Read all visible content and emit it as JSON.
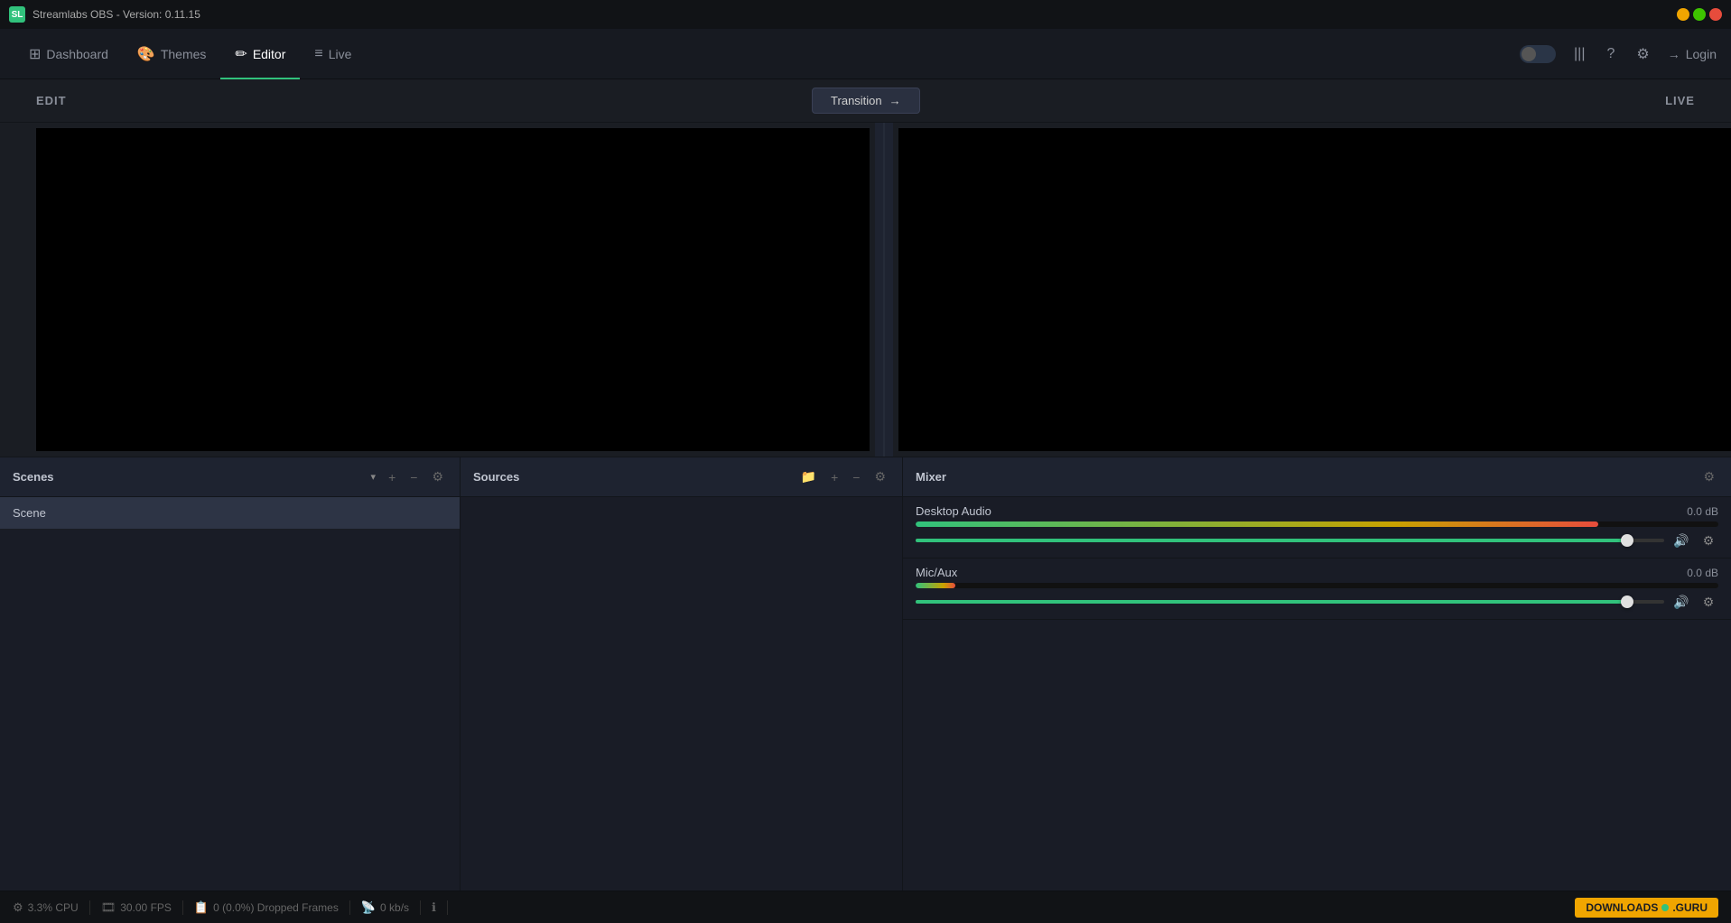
{
  "app": {
    "title": "Streamlabs OBS - Version: 0.11.15",
    "icon_label": "SL"
  },
  "titlebar": {
    "minimize_label": "−",
    "maximize_label": "□",
    "close_label": "×"
  },
  "nav": {
    "items": [
      {
        "id": "dashboard",
        "label": "Dashboard",
        "icon": "⊞"
      },
      {
        "id": "themes",
        "label": "Themes",
        "icon": "🎨"
      },
      {
        "id": "editor",
        "label": "Editor",
        "icon": "✏"
      },
      {
        "id": "live",
        "label": "Live",
        "icon": "≡"
      }
    ],
    "active": "editor",
    "login_label": "Login"
  },
  "editor": {
    "edit_label": "EDIT",
    "live_label": "LIVE",
    "transition_label": "Transition",
    "transition_arrow": "→"
  },
  "scenes": {
    "title": "Scenes",
    "dropdown_icon": "▾",
    "add_icon": "+",
    "remove_icon": "−",
    "settings_icon": "⚙",
    "items": [
      {
        "name": "Scene",
        "selected": true
      }
    ]
  },
  "sources": {
    "title": "Sources",
    "folder_icon": "📁",
    "add_icon": "+",
    "remove_icon": "−",
    "settings_icon": "⚙",
    "items": []
  },
  "mixer": {
    "title": "Mixer",
    "settings_icon": "⚙",
    "channels": [
      {
        "name": "Desktop Audio",
        "db": "0.0 dB",
        "meter_fill_pct": 85,
        "fader_pct": 95,
        "muted": false
      },
      {
        "name": "Mic/Aux",
        "db": "0.0 dB",
        "meter_fill_pct": 5,
        "fader_pct": 95,
        "muted": false
      }
    ]
  },
  "statusbar": {
    "cpu_icon": "⚙",
    "cpu_label": "3.3% CPU",
    "fps_icon": "🎞",
    "fps_label": "30.00 FPS",
    "frames_icon": "📋",
    "frames_label": "0 (0.0%) Dropped Frames",
    "bandwidth_icon": "📡",
    "bandwidth_label": "0 kb/s",
    "info_icon": "ℹ",
    "downloads_label": "DOWNLOADS",
    "downloads_site": "GURU"
  }
}
